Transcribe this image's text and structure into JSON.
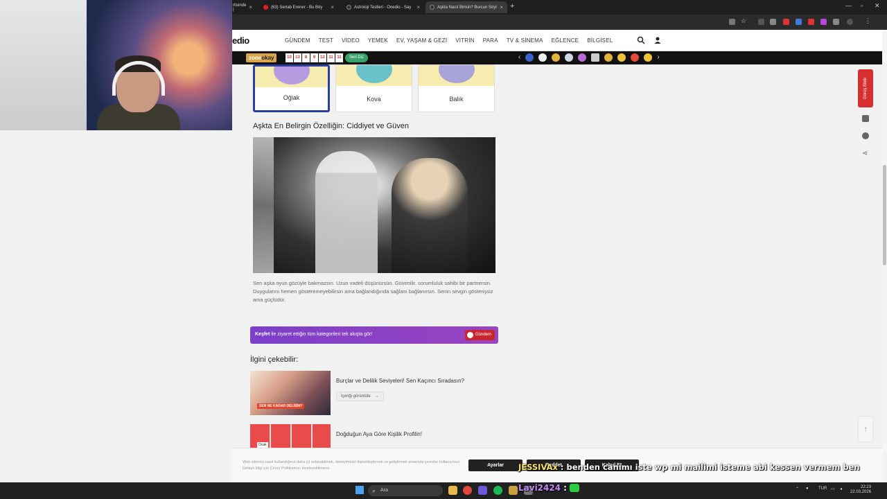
{
  "browser": {
    "tabs": [
      {
        "label": "rtisinde |"
      },
      {
        "label": "(63) Sertab Erener - Bu Böy"
      },
      {
        "label": "Astroloji Testleri - Onedio - Say"
      },
      {
        "label": "Aşkta Nasıl Birisin? Burcun Söyl"
      }
    ],
    "new_tab": "+"
  },
  "site": {
    "logo": "edio",
    "nav": [
      "GÜNDEM",
      "TEST",
      "VİDEO",
      "YEMEK",
      "EV, YAŞAM & GEZİ",
      "VİTRİN",
      "PARA",
      "TV & SİNEMA",
      "EĞLENCE",
      "BİLGİSEL"
    ],
    "zone": "zone",
    "zone2": "okay",
    "nums": [
      "10",
      "13",
      "8",
      "9",
      "12",
      "11",
      "11"
    ],
    "seri_label": "Seri Diz"
  },
  "zodiac": [
    {
      "label": "Oğlak",
      "color": "#b79be0"
    },
    {
      "label": "Kova",
      "color": "#6bc1c9"
    },
    {
      "label": "Balık",
      "color": "#a7a2d8"
    }
  ],
  "article": {
    "heading": "Aşkta En Belirgin Özelliğin: Ciddiyet ve Güven",
    "paragraph": "Sen aşka oyun gözüyle bakmazsın. Uzun vadeli düşünürsün. Güvenilir, sorumluluk sahibi bir partnersin. Duygularını hemen gösteremeyebilirsin ama bağlandığında sağlam bağlanırsın. Senin sevgin gösterişsiz ama güçlüdür."
  },
  "kesfet": {
    "text_bold": "Keşfet",
    "text": " ile ziyaret ettiğin tüm kategorileri tek akışta gör!",
    "badge": "Gündem"
  },
  "recommendations": {
    "heading": "İlgini çekebilir:",
    "items": [
      {
        "title": "Burçlar ve Delilik Seviyeleri! Sen Kaçıncı Sıradasın?",
        "button": "İçeriği görüntüle",
        "thumb_text": "SEN NE KADAR DELİSİN?"
      },
      {
        "title": "Doğduğun Aya Göre Kişilik Profilin!",
        "button": "",
        "thumb_text": "Ocak"
      }
    ]
  },
  "side": {
    "gorus": "Görüş Bildir"
  },
  "cookie": {
    "text": "Web sitemizi nasıl kullandığınız daha iyi anlayabilmek, deneyiminizi kişiselleştirmek ve geliştirmek amacıyla çerezler kullanıyoruz. Detaylı bilgi için Çerez Politikamızı inceleyebilirsiniz.",
    "accept": "Kabul Et",
    "settings": "Ayarlar",
    "reject": "Reddet"
  },
  "chat": {
    "user1": "JESSIVAx",
    "msg1": " : benden canımı iste wp mi mailimi isteme abi kessen vermem ben",
    "user2": "Lavi2424",
    "msg2": " :"
  },
  "taskbar": {
    "search": "Ara",
    "lang": "TUR",
    "time": "22:23",
    "date": "22.03.2026"
  }
}
